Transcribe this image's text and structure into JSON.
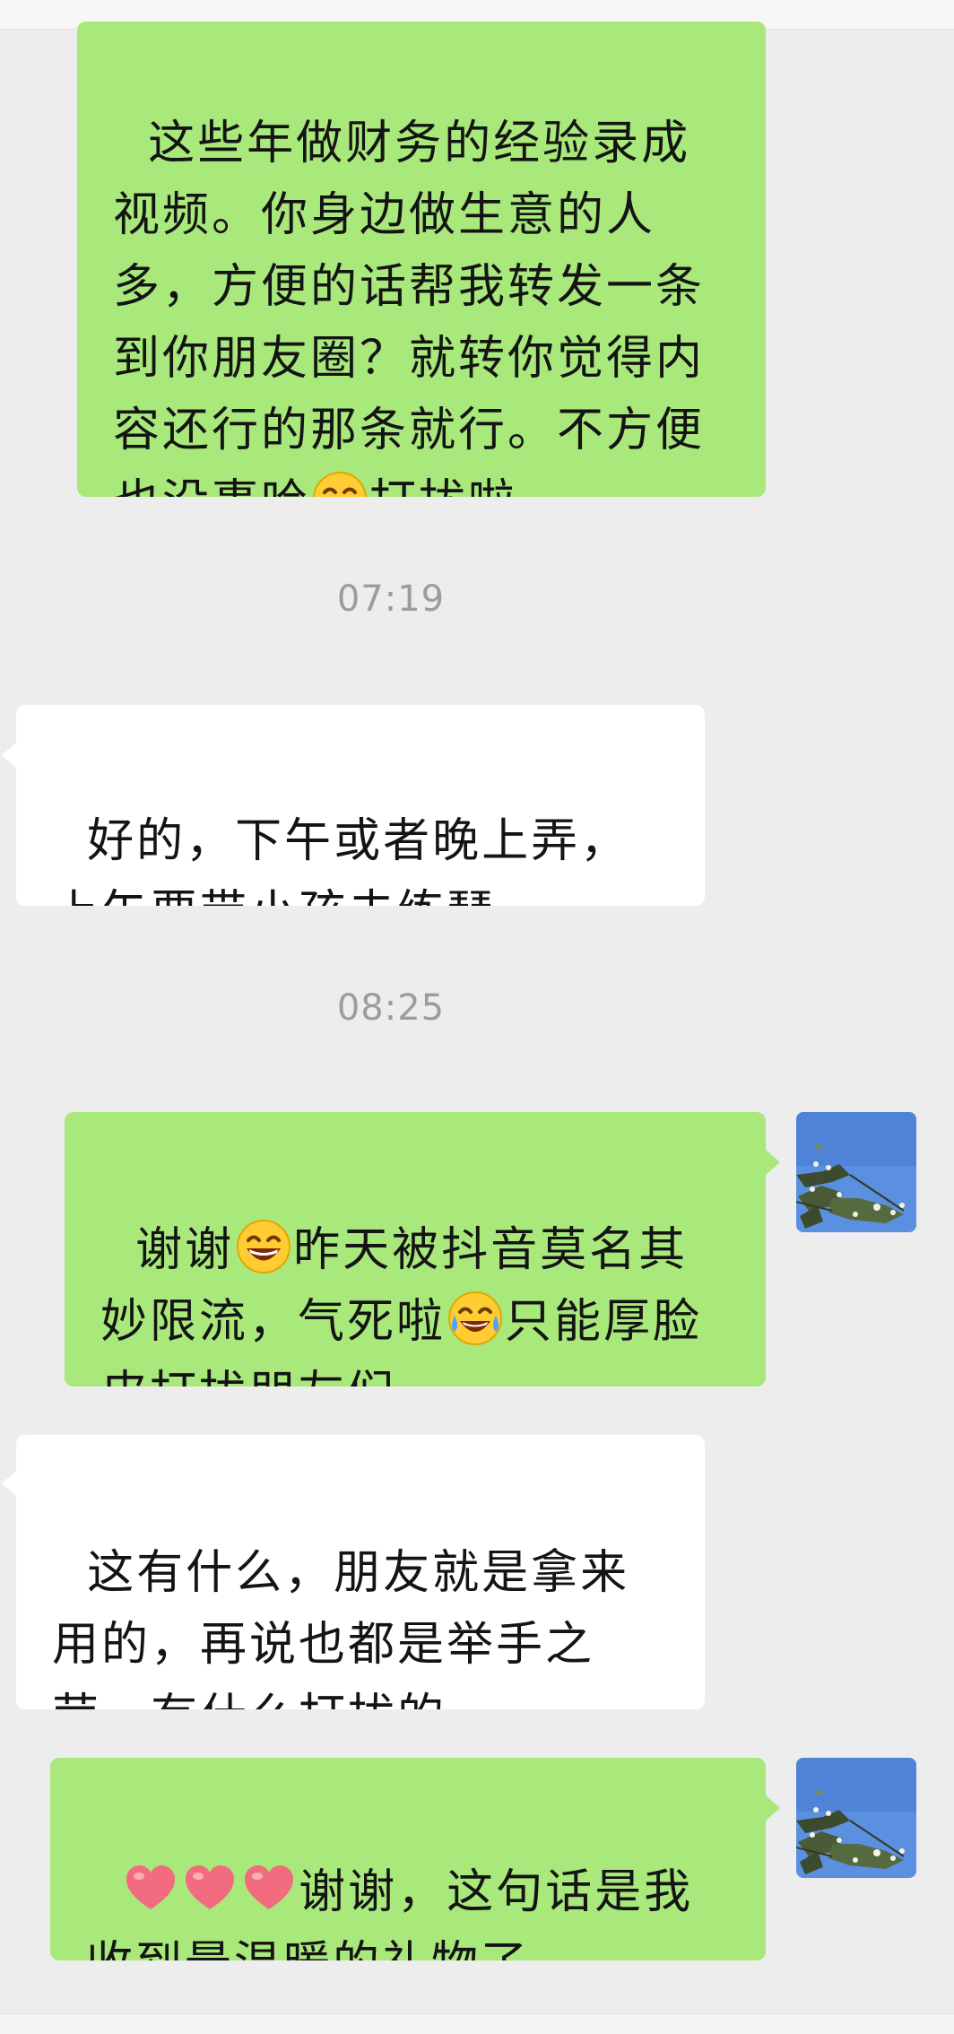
{
  "messages": [
    {
      "side": "mine",
      "parts": [
        {
          "text": "这些年做财务的经验录成视频。你身边做生意的人多，方便的话帮我转发一条到你朋友圈？就转你觉得内容还行的那条就行。不方便也没事哈"
        },
        {
          "emoji": "grin-emoji"
        },
        {
          "text": "打扰啦"
        }
      ]
    },
    {
      "time": "07:19"
    },
    {
      "side": "theirs",
      "parts": [
        {
          "text": "好的，下午或者晚上弄，上午要带小孩去练琴"
        }
      ]
    },
    {
      "time": "08:25"
    },
    {
      "side": "mine",
      "parts": [
        {
          "text": "谢谢"
        },
        {
          "emoji": "grin-emoji"
        },
        {
          "text": "昨天被抖音莫名其妙限流，气死啦"
        },
        {
          "emoji": "tears-of-joy-emoji"
        },
        {
          "text": "只能厚脸皮打扰朋友们"
        }
      ]
    },
    {
      "side": "theirs",
      "parts": [
        {
          "text": "这有什么，朋友就是拿来用的，再说也都是举手之劳，有什么打扰的"
        }
      ]
    },
    {
      "side": "mine",
      "parts": [
        {
          "emoji": "heart-emoji"
        },
        {
          "emoji": "heart-emoji"
        },
        {
          "emoji": "heart-emoji"
        },
        {
          "text": "谢谢，这句话是我收到最温暖的礼物了"
        }
      ]
    }
  ],
  "colors": {
    "background": "#ededed",
    "mine_bubble": "#a9e87b",
    "theirs_bubble": "#ffffff",
    "timestamp": "#9c9c9c"
  }
}
